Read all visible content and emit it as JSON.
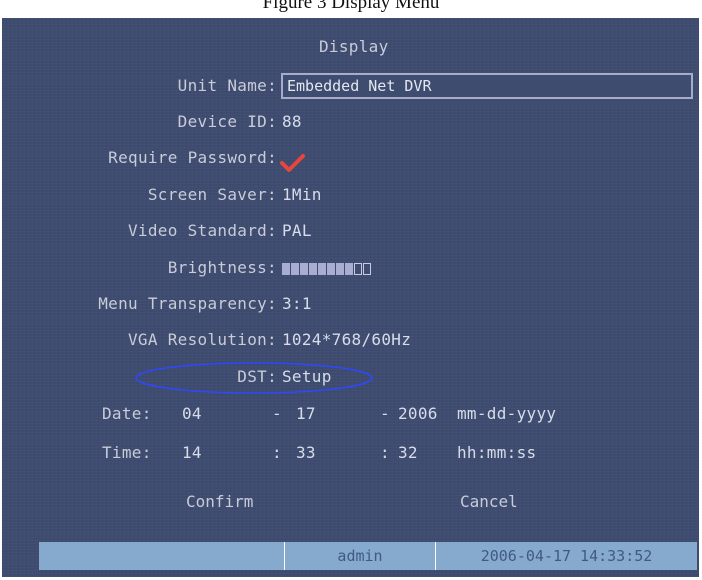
{
  "caption": "Figure 3 Display Menu",
  "menu": {
    "title": "Display",
    "unit_name": {
      "label": "Unit Name:",
      "value": "Embedded Net DVR"
    },
    "device_id": {
      "label": "Device ID:",
      "value": "88"
    },
    "require_password": {
      "label": "Require Password:",
      "checked": true,
      "icon": "check-icon"
    },
    "screen_saver": {
      "label": "Screen Saver:",
      "value": "1Min"
    },
    "video_standard": {
      "label": "Video Standard:",
      "value": "PAL"
    },
    "brightness": {
      "label": "Brightness:",
      "level": 8,
      "max": 10
    },
    "menu_transparency": {
      "label": "Menu Transparency:",
      "value": "3:1"
    },
    "vga_resolution": {
      "label": "VGA Resolution:",
      "value": "1024*768/60Hz"
    },
    "dst": {
      "label": "DST:",
      "value": "Setup"
    },
    "date": {
      "label": "Date:",
      "month": "04",
      "day": "17",
      "year": "2006",
      "sep": "-",
      "format": "mm-dd-yyyy"
    },
    "time": {
      "label": "Time:",
      "hour": "14",
      "minute": "33",
      "second": "32",
      "sep": ":",
      "format": "hh:mm:ss"
    },
    "confirm_label": "Confirm",
    "cancel_label": "Cancel"
  },
  "status_bar": {
    "user": "admin",
    "datetime": "2006-04-17 14:33:52"
  },
  "colors": {
    "background": "#3e4c70",
    "text": "#c9ccd8",
    "checkmark": "#e8463c",
    "highlight": "#2f47ff",
    "status_bar": "#86a9ce"
  }
}
